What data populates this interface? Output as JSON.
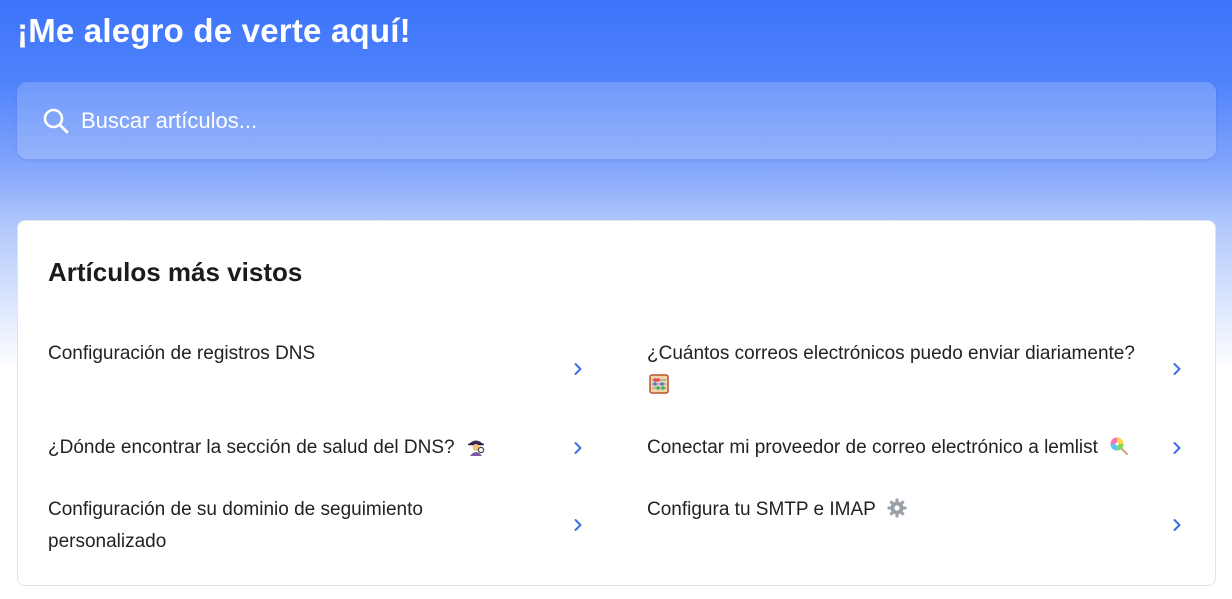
{
  "hero": {
    "title": "¡Me alegro de verte aquí!"
  },
  "search": {
    "placeholder": "Buscar artículos...",
    "icon": "search-icon"
  },
  "popular": {
    "title": "Artículos más vistos",
    "articles": [
      {
        "label": "Configuración de registros DNS",
        "emoji": null
      },
      {
        "label": "¿Cuántos correos electrónicos puedo enviar diariamente?",
        "emoji": "abacus-icon"
      },
      {
        "label": "¿Dónde encontrar la sección de salud del DNS?",
        "emoji": "detective-icon"
      },
      {
        "label": "Conectar mi proveedor de correo electrónico a lemlist",
        "emoji": "lollipop-icon"
      },
      {
        "label": "Configuración de su dominio de seguimiento personalizado",
        "emoji": null
      },
      {
        "label": "Configura tu SMTP e IMAP",
        "emoji": "gear-icon"
      }
    ]
  },
  "colors": {
    "brand_blue": "#3c74fb",
    "chevron": "#3a6fe6",
    "text": "#222222"
  }
}
